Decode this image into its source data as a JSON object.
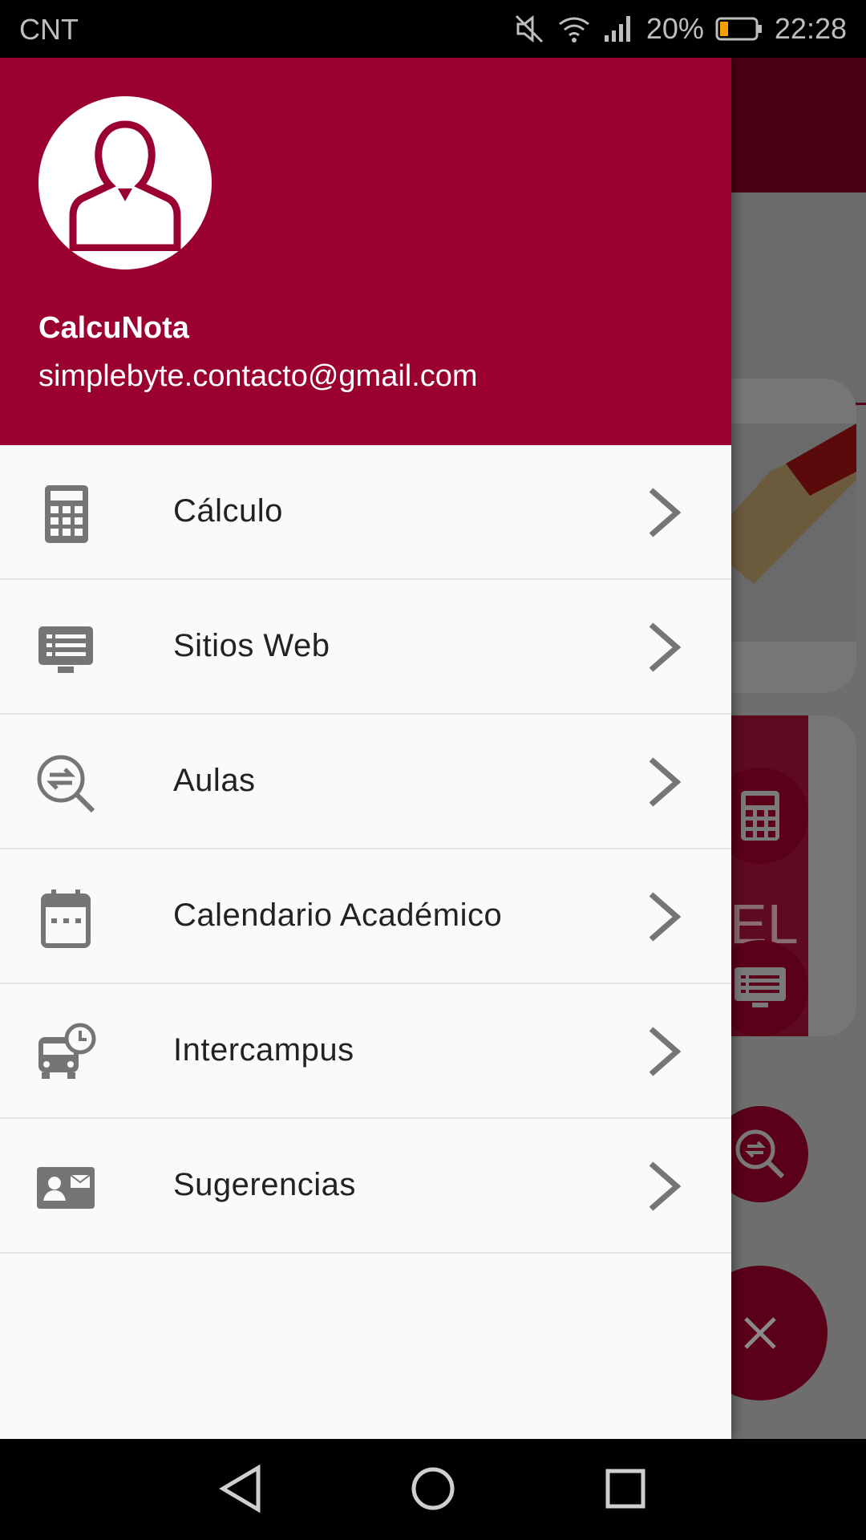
{
  "status_bar": {
    "carrier": "CNT",
    "battery_percent": "20%",
    "time": "22:28"
  },
  "drawer": {
    "header": {
      "app_name": "CalcuNota",
      "email": "simplebyte.contacto@gmail.com"
    },
    "items": [
      {
        "label": "Cálculo",
        "icon": "calculator-icon"
      },
      {
        "label": "Sitios Web",
        "icon": "monitor-list-icon"
      },
      {
        "label": "Aulas",
        "icon": "search-swap-icon"
      },
      {
        "label": "Calendario Académico",
        "icon": "calendar-icon"
      },
      {
        "label": "Intercampus",
        "icon": "bus-clock-icon"
      },
      {
        "label": "Sugerencias",
        "icon": "contact-card-icon"
      }
    ]
  },
  "background": {
    "partial_text": "EL"
  },
  "colors": {
    "header": "#9a0030",
    "icon_gray": "#757575",
    "drawer_bg": "#fafafa"
  }
}
